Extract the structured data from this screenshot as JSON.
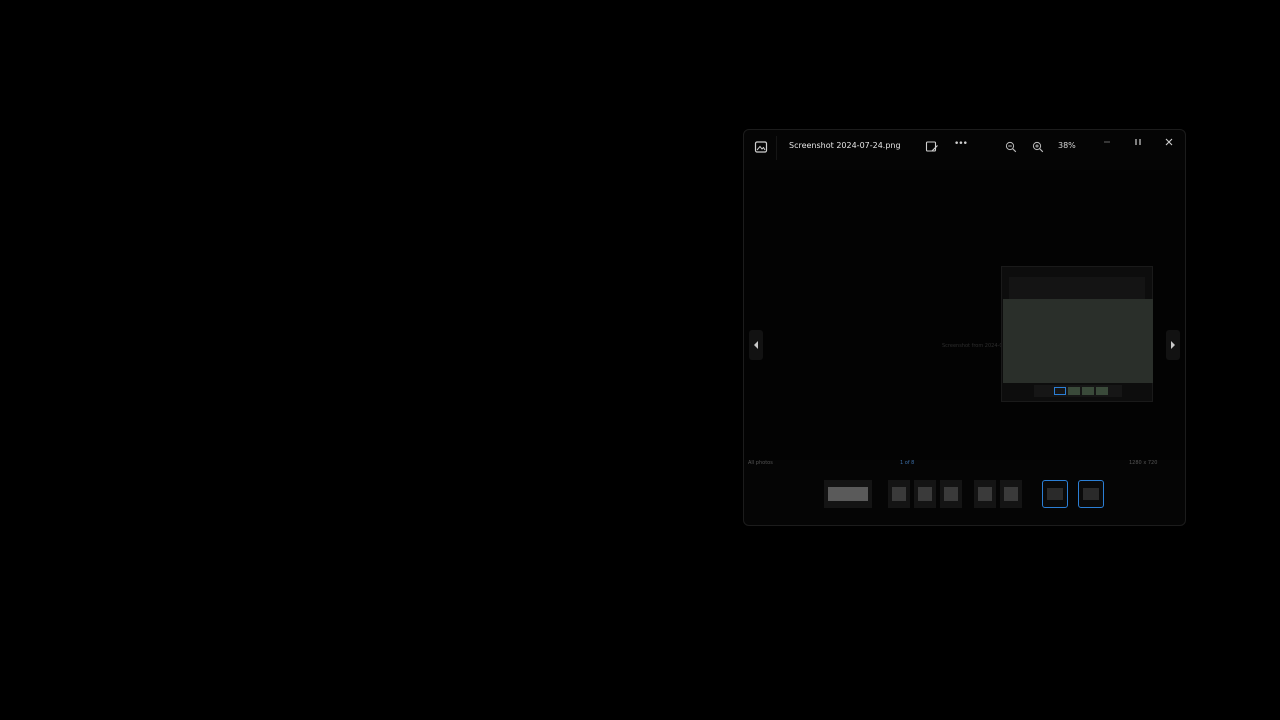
{
  "window": {
    "file_name": "Screenshot 2024-07-24.png",
    "zoom_label": "38%",
    "more_label": "•••",
    "icons": [
      "photos-app-icon",
      "edit-image-icon",
      "zoom-out-icon",
      "zoom-in-icon",
      "minimize-icon",
      "maximize-icon",
      "close-icon"
    ]
  },
  "stage": {
    "center_caption": "Screenshot from 2024-07-24",
    "nested_caption": "Screenshot 2024-07-24.png"
  },
  "info_row": {
    "left_label": "All photos",
    "middle_label": "1 of 8",
    "right_label": "1280 x 720"
  },
  "filmstrip": {
    "count": 8,
    "selected_indices": [
      6,
      7
    ]
  },
  "colors": {
    "accent": "#2b7fd6",
    "window_bg": "#050505"
  }
}
